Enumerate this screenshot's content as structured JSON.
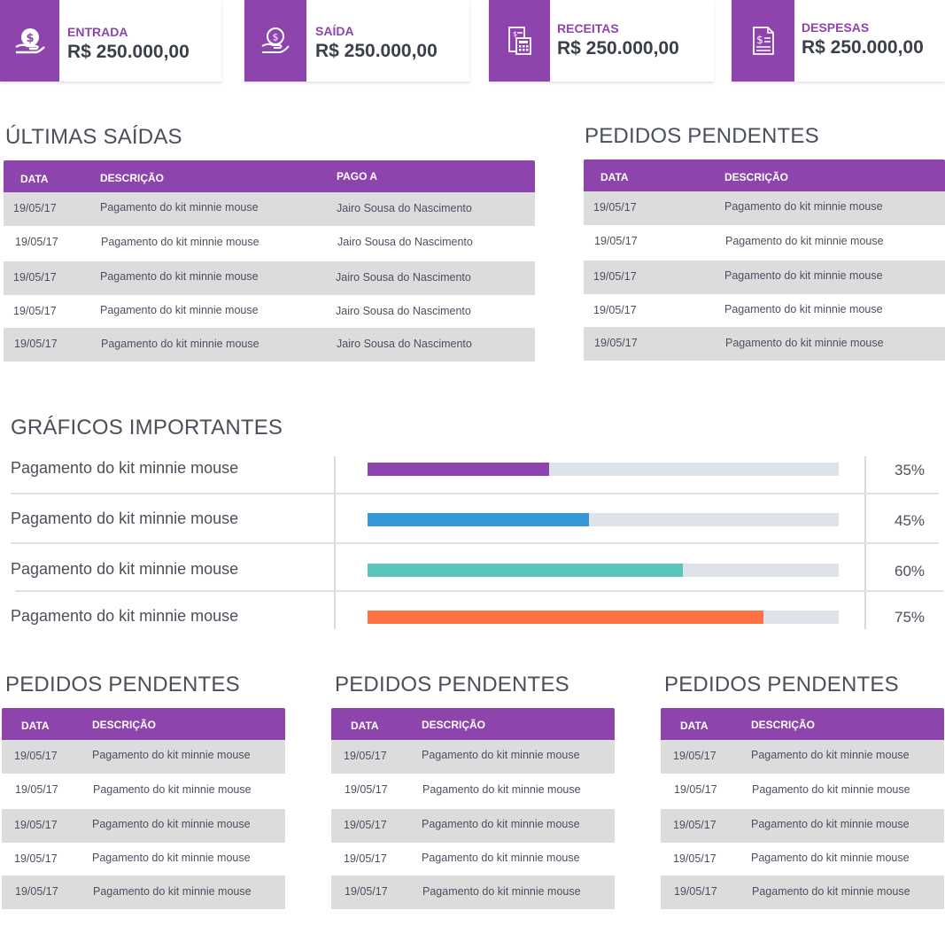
{
  "cards": [
    {
      "label": "ENTRADA",
      "value": "R$ 250.000,00",
      "icon": "hand-money-icon"
    },
    {
      "label": "SAÍDA",
      "value": "R$ 250.000,00",
      "icon": "hand-coin-icon"
    },
    {
      "label": "RECEITAS",
      "value": "R$ 250.000,00",
      "icon": "calculator-receipt-icon"
    },
    {
      "label": "DESPESAS",
      "value": "R$ 250.000,00",
      "icon": "invoice-dollar-icon"
    }
  ],
  "ultimas_saidas": {
    "title": "ÚLTIMAS SAÍDAS",
    "headers": [
      "DATA",
      "DESCRIÇÃO",
      "PAGO A"
    ],
    "rows": [
      [
        "19/05/17",
        "Pagamento do kit minnie mouse",
        "Jairo Sousa do Nascimento"
      ],
      [
        "19/05/17",
        "Pagamento do kit minnie mouse",
        "Jairo Sousa do Nascimento"
      ],
      [
        "19/05/17",
        "Pagamento do kit minnie mouse",
        "Jairo Sousa do Nascimento"
      ],
      [
        "19/05/17",
        "Pagamento do kit minnie mouse",
        "Jairo Sousa do Nascimento"
      ],
      [
        "19/05/17",
        "Pagamento do kit minnie mouse",
        "Jairo Sousa do Nascimento"
      ]
    ]
  },
  "pedidos_top": {
    "title": "PEDIDOS PENDENTES",
    "headers": [
      "DATA",
      "DESCRIÇÃO"
    ],
    "rows": [
      [
        "19/05/17",
        "Pagamento do kit minnie mouse"
      ],
      [
        "19/05/17",
        "Pagamento do kit minnie mouse"
      ],
      [
        "19/05/17",
        "Pagamento do kit minnie mouse"
      ],
      [
        "19/05/17",
        "Pagamento do kit minnie mouse"
      ],
      [
        "19/05/17",
        "Pagamento do kit minnie mouse"
      ]
    ]
  },
  "graficos": {
    "title": "GRÁFICOS IMPORTANTES",
    "items": [
      {
        "label": "Pagamento do kit minnie mouse",
        "percent_text": "35%",
        "value": 0.385,
        "color": "#8e44ad"
      },
      {
        "label": "Pagamento do kit minnie mouse",
        "percent_text": "45%",
        "value": 0.47,
        "color": "#3498db"
      },
      {
        "label": "Pagamento do kit minnie mouse",
        "percent_text": "60%",
        "value": 0.67,
        "color": "#5bc4bb"
      },
      {
        "label": "Pagamento do kit minnie mouse",
        "percent_text": "75%",
        "value": 0.84,
        "color": "#ff7043"
      }
    ]
  },
  "pedidos_bottom": [
    {
      "title": "PEDIDOS PENDENTES",
      "headers": [
        "DATA",
        "DESCRIÇÃO"
      ],
      "rows": [
        [
          "19/05/17",
          "Pagamento do kit minnie mouse"
        ],
        [
          "19/05/17",
          "Pagamento do kit minnie mouse"
        ],
        [
          "19/05/17",
          "Pagamento do kit minnie mouse"
        ],
        [
          "19/05/17",
          "Pagamento do kit minnie mouse"
        ],
        [
          "19/05/17",
          "Pagamento do kit minnie mouse"
        ]
      ]
    },
    {
      "title": "PEDIDOS PENDENTES",
      "headers": [
        "DATA",
        "DESCRIÇÃO"
      ],
      "rows": [
        [
          "19/05/17",
          "Pagamento do kit minnie mouse"
        ],
        [
          "19/05/17",
          "Pagamento do kit minnie mouse"
        ],
        [
          "19/05/17",
          "Pagamento do kit minnie mouse"
        ],
        [
          "19/05/17",
          "Pagamento do kit minnie mouse"
        ],
        [
          "19/05/17",
          "Pagamento do kit minnie mouse"
        ]
      ]
    },
    {
      "title": "PEDIDOS PENDENTES",
      "headers": [
        "DATA",
        "DESCRIÇÃO"
      ],
      "rows": [
        [
          "19/05/17",
          "Pagamento do kit minnie mouse"
        ],
        [
          "19/05/17",
          "Pagamento do kit minnie mouse"
        ],
        [
          "19/05/17",
          "Pagamento do kit minnie mouse"
        ],
        [
          "19/05/17",
          "Pagamento do kit minnie mouse"
        ],
        [
          "19/05/17",
          "Pagamento do kit minnie mouse"
        ]
      ]
    }
  ],
  "colors": {
    "accent": "#8e44ad",
    "row_alt": "#dcdcdc",
    "track": "#dde3e8"
  }
}
